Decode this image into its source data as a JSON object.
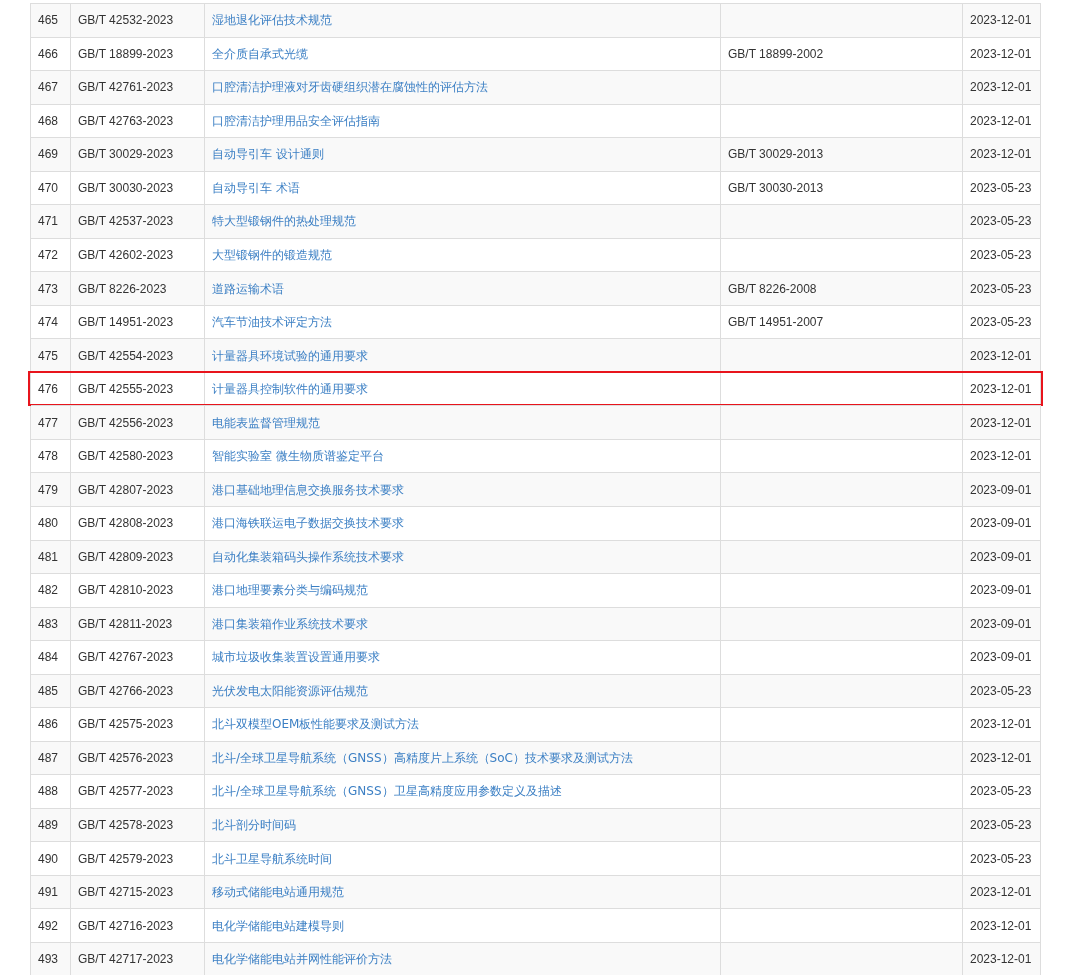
{
  "table": {
    "rows": [
      {
        "no": "465",
        "code": "GB/T 42532-2023",
        "title": "湿地退化评估技术规范",
        "date": "2023-12-01",
        "highlighted": false
      },
      {
        "no": "466",
        "code": "GB/T 18899-2023",
        "title": "全介质自承式光缆",
        "replaces": "GB/T 18899-2002",
        "date": "2023-12-01",
        "highlighted": false
      },
      {
        "no": "467",
        "code": "GB/T 42761-2023",
        "title": "口腔清洁护理液对牙齿硬组织潜在腐蚀性的评估方法",
        "date": "2023-12-01",
        "highlighted": false
      },
      {
        "no": "468",
        "code": "GB/T 42763-2023",
        "title": "口腔清洁护理用品安全评估指南",
        "date": "2023-12-01",
        "highlighted": false
      },
      {
        "no": "469",
        "code": "GB/T 30029-2023",
        "title": "自动导引车 设计通则",
        "replaces": "GB/T 30029-2013",
        "date": "2023-12-01",
        "highlighted": false
      },
      {
        "no": "470",
        "code": "GB/T 30030-2023",
        "title": "自动导引车 术语",
        "replaces": "GB/T 30030-2013",
        "date": "2023-05-23",
        "highlighted": false
      },
      {
        "no": "471",
        "code": "GB/T 42537-2023",
        "title": "特大型锻钢件的热处理规范",
        "date": "2023-05-23",
        "highlighted": false
      },
      {
        "no": "472",
        "code": "GB/T 42602-2023",
        "title": "大型锻钢件的锻造规范",
        "date": "2023-05-23",
        "highlighted": false
      },
      {
        "no": "473",
        "code": "GB/T 8226-2023",
        "title": "道路运输术语",
        "replaces": "GB/T 8226-2008",
        "date": "2023-05-23",
        "highlighted": false
      },
      {
        "no": "474",
        "code": "GB/T 14951-2023",
        "title": "汽车节油技术评定方法",
        "replaces": "GB/T 14951-2007",
        "date": "2023-05-23",
        "highlighted": false
      },
      {
        "no": "475",
        "code": "GB/T 42554-2023",
        "title": "计量器具环境试验的通用要求",
        "date": "2023-12-01",
        "highlighted": false
      },
      {
        "no": "476",
        "code": "GB/T 42555-2023",
        "title": "计量器具控制软件的通用要求",
        "date": "2023-12-01",
        "highlighted": true
      },
      {
        "no": "477",
        "code": "GB/T 42556-2023",
        "title": "电能表监督管理规范",
        "date": "2023-12-01",
        "highlighted": false
      },
      {
        "no": "478",
        "code": "GB/T 42580-2023",
        "title": "智能实验室 微生物质谱鉴定平台",
        "date": "2023-12-01",
        "highlighted": false
      },
      {
        "no": "479",
        "code": "GB/T 42807-2023",
        "title": "港口基础地理信息交换服务技术要求",
        "date": "2023-09-01",
        "highlighted": false
      },
      {
        "no": "480",
        "code": "GB/T 42808-2023",
        "title": "港口海铁联运电子数据交换技术要求",
        "date": "2023-09-01",
        "highlighted": false
      },
      {
        "no": "481",
        "code": "GB/T 42809-2023",
        "title": "自动化集装箱码头操作系统技术要求",
        "date": "2023-09-01",
        "highlighted": false
      },
      {
        "no": "482",
        "code": "GB/T 42810-2023",
        "title": "港口地理要素分类与编码规范",
        "date": "2023-09-01",
        "highlighted": false
      },
      {
        "no": "483",
        "code": "GB/T 42811-2023",
        "title": "港口集装箱作业系统技术要求",
        "date": "2023-09-01",
        "highlighted": false
      },
      {
        "no": "484",
        "code": "GB/T 42767-2023",
        "title": "城市垃圾收集装置设置通用要求",
        "date": "2023-09-01",
        "highlighted": false
      },
      {
        "no": "485",
        "code": "GB/T 42766-2023",
        "title": "光伏发电太阳能资源评估规范",
        "date": "2023-05-23",
        "highlighted": false
      },
      {
        "no": "486",
        "code": "GB/T 42575-2023",
        "title": "北斗双模型OEM板性能要求及测试方法",
        "date": "2023-12-01",
        "highlighted": false
      },
      {
        "no": "487",
        "code": "GB/T 42576-2023",
        "title": "北斗/全球卫星导航系统（GNSS）高精度片上系统（SoC）技术要求及测试方法",
        "date": "2023-12-01",
        "highlighted": false
      },
      {
        "no": "488",
        "code": "GB/T 42577-2023",
        "title": "北斗/全球卫星导航系统（GNSS）卫星高精度应用参数定义及描述",
        "date": "2023-05-23",
        "highlighted": false
      },
      {
        "no": "489",
        "code": "GB/T 42578-2023",
        "title": "北斗剖分时间码",
        "date": "2023-05-23",
        "highlighted": false
      },
      {
        "no": "490",
        "code": "GB/T 42579-2023",
        "title": "北斗卫星导航系统时间",
        "date": "2023-05-23",
        "highlighted": false
      },
      {
        "no": "491",
        "code": "GB/T 42715-2023",
        "title": "移动式储能电站通用规范",
        "date": "2023-12-01",
        "highlighted": false
      },
      {
        "no": "492",
        "code": "GB/T 42716-2023",
        "title": "电化学储能电站建模导则",
        "date": "2023-12-01",
        "highlighted": false
      },
      {
        "no": "493",
        "code": "GB/T 42717-2023",
        "title": "电化学储能电站并网性能评价方法",
        "date": "2023-12-01",
        "highlighted": false
      }
    ]
  }
}
